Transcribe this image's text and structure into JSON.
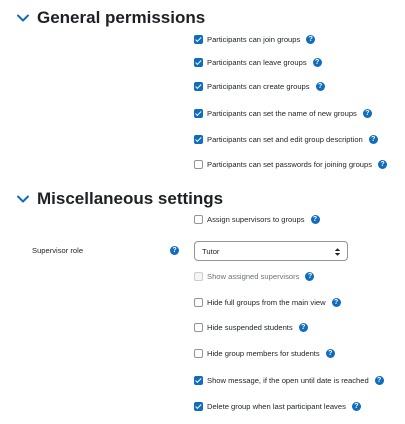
{
  "sections": {
    "general": {
      "title": "General permissions"
    },
    "misc": {
      "title": "Miscellaneous settings"
    }
  },
  "general_items": [
    {
      "label": "Participants can join groups",
      "checked": true
    },
    {
      "label": "Participants can leave groups",
      "checked": true
    },
    {
      "label": "Participants can create groups",
      "checked": true
    },
    {
      "label": "Participants can set the name of new groups",
      "checked": true
    },
    {
      "label": "Participants can set and edit group description",
      "checked": true
    },
    {
      "label": "Participants can set passwords for joining groups",
      "checked": false
    }
  ],
  "misc": {
    "assign_supervisors": {
      "label": "Assign supervisors to groups",
      "checked": false
    },
    "supervisor_role": {
      "label": "Supervisor role",
      "value": "Tutor"
    },
    "items": [
      {
        "label": "Show assigned supervisors",
        "checked": false,
        "disabled": true
      },
      {
        "label": "Hide full groups from the main view",
        "checked": false
      },
      {
        "label": "Hide suspended students",
        "checked": false
      },
      {
        "label": "Hide group members for students",
        "checked": false
      },
      {
        "label": "Show message, if the open until date is reached",
        "checked": true
      },
      {
        "label": "Delete group when last participant leaves",
        "checked": true
      }
    ]
  },
  "help_glyph": "?",
  "icons": {
    "section_toggle": "chevron-down-icon",
    "help": "help-icon",
    "select_arrow": "sort-arrows-icon"
  },
  "colors": {
    "accent": "#0f6cbf",
    "text": "#1d2125",
    "muted_text": "#6a737b"
  }
}
